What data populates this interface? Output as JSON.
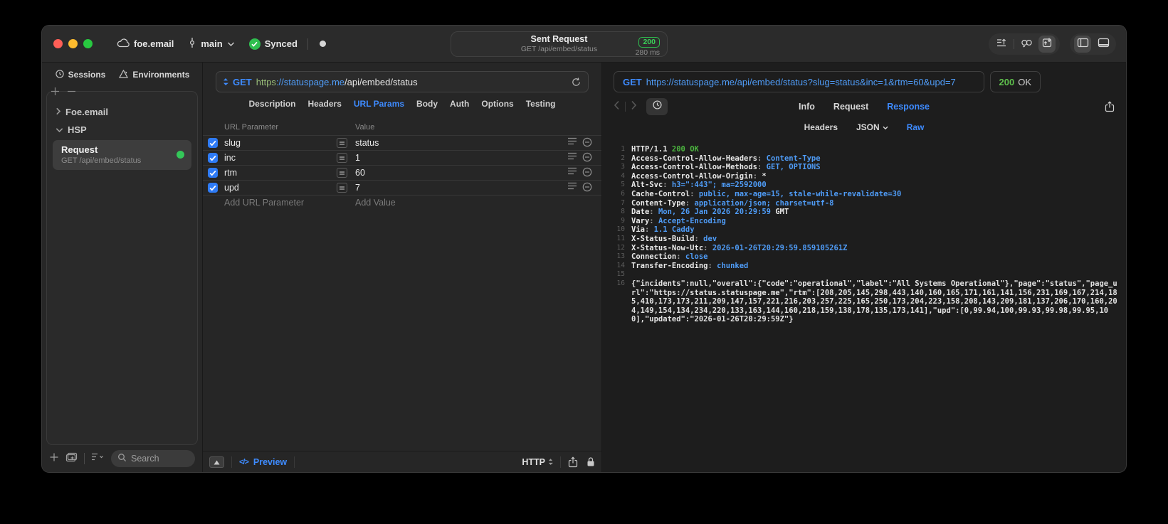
{
  "colors": {
    "accent_blue": "#3e8bff",
    "status_green": "#32d74b",
    "checkbox_blue": "#2e7bf6",
    "url_scheme_green": "#9bc07a"
  },
  "titlebar": {
    "project_name": "foe.email",
    "branch_name": "main",
    "sync_label": "Synced",
    "request_summary": {
      "title": "Sent Request",
      "subtitle": "GET /api/embed/status",
      "status_code": "200",
      "response_time": "280 ms"
    }
  },
  "sidebar": {
    "tabs": [
      {
        "label": "Sessions",
        "icon": "clock"
      },
      {
        "label": "Environments",
        "icon": "env"
      }
    ],
    "groups": [
      {
        "label": "Foe.email",
        "expanded": false
      },
      {
        "label": "HSP",
        "expanded": true
      }
    ],
    "request_item": {
      "title": "Request",
      "subtitle": "GET /api/embed/status",
      "selected": true
    },
    "search": {
      "placeholder": "Search"
    }
  },
  "request_editor": {
    "method": "GET",
    "url_scheme": "https",
    "url_host": "://statuspage.me",
    "url_path": "/api/embed/status",
    "tabs": [
      {
        "label": "Description",
        "active": false
      },
      {
        "label": "Headers",
        "active": false
      },
      {
        "label": "URL Params",
        "active": true
      },
      {
        "label": "Body",
        "active": false
      },
      {
        "label": "Auth",
        "active": false
      },
      {
        "label": "Options",
        "active": false
      },
      {
        "label": "Testing",
        "active": false
      }
    ],
    "params": {
      "col_name": "URL Parameter",
      "col_value": "Value",
      "rows": [
        {
          "name": "slug",
          "value": "status",
          "enabled": true
        },
        {
          "name": "inc",
          "value": "1",
          "enabled": true
        },
        {
          "name": "rtm",
          "value": "60",
          "enabled": true
        },
        {
          "name": "upd",
          "value": "7",
          "enabled": true
        }
      ],
      "add_name": "Add URL Parameter",
      "add_value": "Add Value"
    },
    "footer": {
      "preview_label": "Preview",
      "format_label": "HTTP"
    }
  },
  "response_viewer": {
    "method": "GET",
    "url": "https://statuspage.me/api/embed/status?slug=status&inc=1&rtm=60&upd=7",
    "status_code": "200",
    "status_text": "OK",
    "tabs": [
      {
        "label": "Info",
        "active": false
      },
      {
        "label": "Request",
        "active": false
      },
      {
        "label": "Response",
        "active": true
      }
    ],
    "subtabs": [
      {
        "label": "Headers",
        "active": false,
        "dropdown": false
      },
      {
        "label": "JSON",
        "active": false,
        "dropdown": true
      },
      {
        "label": "Raw",
        "active": true,
        "dropdown": false
      }
    ],
    "code_lines": [
      {
        "n": "1",
        "segs": [
          [
            "HTTP/1.1 ",
            "k"
          ],
          [
            "200 OK",
            "g"
          ]
        ]
      },
      {
        "n": "2",
        "segs": [
          [
            "Access-Control-Allow-Headers",
            "k"
          ],
          [
            ": ",
            "p"
          ],
          [
            "Content-Type",
            "v"
          ]
        ]
      },
      {
        "n": "3",
        "segs": [
          [
            "Access-Control-Allow-Methods",
            "k"
          ],
          [
            ": ",
            "p"
          ],
          [
            "GET, OPTIONS",
            "v"
          ]
        ]
      },
      {
        "n": "4",
        "segs": [
          [
            "Access-Control-Allow-Origin",
            "k"
          ],
          [
            ": ",
            "p"
          ],
          [
            "*",
            "k"
          ]
        ]
      },
      {
        "n": "5",
        "segs": [
          [
            "Alt-Svc",
            "k"
          ],
          [
            ": ",
            "p"
          ],
          [
            "h3=\":443\"; ma=2592000",
            "v"
          ]
        ]
      },
      {
        "n": "6",
        "segs": [
          [
            "Cache-Control",
            "k"
          ],
          [
            ": ",
            "p"
          ],
          [
            "public, max-age=15, stale-while-revalidate=30",
            "v"
          ]
        ]
      },
      {
        "n": "7",
        "segs": [
          [
            "Content-Type",
            "k"
          ],
          [
            ": ",
            "p"
          ],
          [
            "application/json; charset=utf-8",
            "v"
          ]
        ]
      },
      {
        "n": "8",
        "segs": [
          [
            "Date",
            "k"
          ],
          [
            ": ",
            "p"
          ],
          [
            "Mon, 26 Jan 2026 20:29:59",
            "v"
          ],
          [
            " GMT",
            "k"
          ]
        ]
      },
      {
        "n": "9",
        "segs": [
          [
            "Vary",
            "k"
          ],
          [
            ": ",
            "p"
          ],
          [
            "Accept-Encoding",
            "v"
          ]
        ]
      },
      {
        "n": "10",
        "segs": [
          [
            "Via",
            "k"
          ],
          [
            ": ",
            "p"
          ],
          [
            "1.1 Caddy",
            "v"
          ]
        ]
      },
      {
        "n": "11",
        "segs": [
          [
            "X-Status-Build",
            "k"
          ],
          [
            ": ",
            "p"
          ],
          [
            "dev",
            "v"
          ]
        ]
      },
      {
        "n": "12",
        "segs": [
          [
            "X-Status-Now-Utc",
            "k"
          ],
          [
            ": ",
            "p"
          ],
          [
            "2026-01-26T20:29:59.859105261Z",
            "v"
          ]
        ]
      },
      {
        "n": "13",
        "segs": [
          [
            "Connection",
            "k"
          ],
          [
            ": ",
            "p"
          ],
          [
            "close",
            "v"
          ]
        ]
      },
      {
        "n": "14",
        "segs": [
          [
            "Transfer-Encoding",
            "k"
          ],
          [
            ": ",
            "p"
          ],
          [
            "chunked",
            "v"
          ]
        ]
      },
      {
        "n": "15",
        "segs": []
      },
      {
        "n": "16",
        "segs": [
          [
            "{\"incidents\":null,\"overall\":{\"code\":\"operational\",\"label\":\"All Systems Operational\"},\"page\":\"status\",\"page_url\":\"https://status.statuspage.me\",\"rtm\":[208,205,145,298,443,140,160,165,171,161,141,156,231,169,167,214,185,410,173,173,211,209,147,157,221,216,203,257,225,165,250,173,204,223,158,208,143,209,181,137,206,170,160,204,149,154,134,234,220,133,163,144,160,218,159,138,178,135,173,141],\"upd\":[0,99.94,100,99.93,99.98,99.95,100],\"updated\":\"2026-01-26T20:29:59Z\"}",
            "t"
          ]
        ]
      }
    ]
  }
}
